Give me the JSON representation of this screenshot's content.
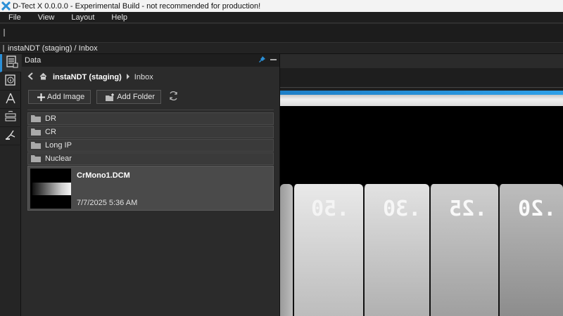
{
  "window": {
    "title": "D-Tect X 0.0.0.0 - Experimental Build - not recommended for production!"
  },
  "menu": [
    "File",
    "View",
    "Layout",
    "Help"
  ],
  "path": "instaNDT (staging) / Inbox",
  "panel": {
    "title": "Data",
    "breadcrumb": {
      "root": "instaNDT (staging)",
      "leaf": "Inbox"
    },
    "add_image": "Add Image",
    "add_folder": "Add Folder",
    "folders": [
      "DR",
      "CR",
      "Long IP",
      "Nuclear"
    ],
    "file": {
      "name": "CrMono1.DCM",
      "date": "7/7/2025 5:36 AM"
    }
  },
  "viewer": {
    "plate_labels": [
      ".50",
      ".30",
      ".25",
      ".20"
    ]
  },
  "colors": {
    "accent": "#2b8fd6",
    "panel_bg": "#2b2b2b",
    "titlebar_bg": "#f3f3f3"
  },
  "icons": [
    "app-logo-icon",
    "data-browser-icon",
    "info-icon",
    "measure-icon",
    "storage-icon",
    "tools-icon",
    "pin-icon",
    "minimize-icon",
    "back-icon",
    "home-icon",
    "chevron-right-icon",
    "add-icon",
    "add-folder-icon",
    "refresh-icon",
    "folder-icon"
  ]
}
